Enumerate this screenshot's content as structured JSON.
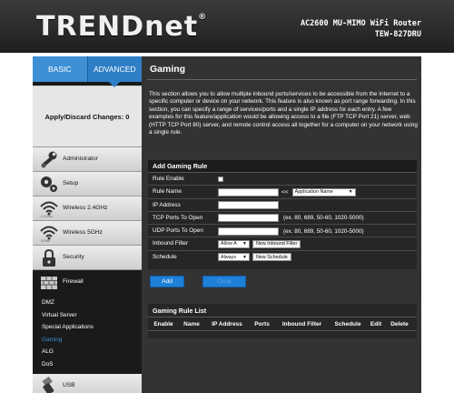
{
  "header": {
    "logo": "TRENDnet",
    "logo_reg": "®",
    "model_line1": "AC2600 MU-MIMO WiFi Router",
    "model_line2": "TEW-827DRU"
  },
  "tabs": {
    "basic": "BASIC",
    "advanced": "ADVANCED",
    "active": "ADVANCED"
  },
  "apply_label": "Apply/Discard Changes: 0",
  "nav": {
    "administrator": {
      "label": "Administrator",
      "icon": "wrench-icon"
    },
    "setup": {
      "label": "Setup",
      "icon": "gears-icon"
    },
    "wireless24": {
      "label": "Wireless 2.4GHz",
      "sub": "2.4 GHz",
      "icon": "wifi-icon"
    },
    "wireless5": {
      "label": "Wireless 5GHz",
      "sub": "5 GHz",
      "icon": "wifi-icon"
    },
    "security": {
      "label": "Security",
      "icon": "padlock-icon"
    },
    "firewall": {
      "label": "Firewall",
      "icon": "brick-wall-icon"
    },
    "firewall_sub": [
      "DMZ",
      "Virtual Server",
      "Special Applications",
      "Gaming",
      "ALG",
      "DoS"
    ],
    "firewall_active": "Gaming",
    "usb": {
      "label": "USB",
      "icon": "usb-icon"
    }
  },
  "page": {
    "title": "Gaming",
    "description": "This section allows you to allow multiple inbound ports/services to be accessible from the Internet to a specific computer or device on your network. This feature is also known as port range forwarding. In this section, you can specify a range of services/ports and a single IP address for each entry. A few examples for this feature/application would be allowing access to a file (FTP TCP Port 21) server, web (HTTP TCP Port 80) server, and remote control access all together for a computer on your network using a single rule."
  },
  "form": {
    "title": "Add Gaming Rule",
    "rule_enable_label": "Rule Enable",
    "rule_name_label": "Rule Name",
    "rule_name_value": "",
    "copy_arrows": "<<",
    "app_select_value": "Application Name",
    "ip_label": "IP Address",
    "ip_value": "",
    "tcp_label": "TCP Ports To Open",
    "tcp_value": "",
    "tcp_hint": "(ex. 80, 689, 50-60, 1020-5000)",
    "udp_label": "UDP Ports To Open",
    "udp_value": "",
    "udp_hint": "(ex. 80, 689, 50-60, 1020-5000)",
    "inbound_label": "Inbound Filter",
    "inbound_value": "Allow A",
    "new_inbound_label": "New Inbound Filter",
    "schedule_label": "Schedule",
    "schedule_value": "Always",
    "new_schedule_label": "New Schedule"
  },
  "buttons": {
    "add": "Add",
    "clear": "Clear"
  },
  "list": {
    "title": "Gaming Rule List",
    "columns": [
      "Enable",
      "Name",
      "IP Address",
      "Ports",
      "Inbound Filter",
      "Schedule",
      "Edit",
      "Delete"
    ]
  },
  "colors": {
    "accent": "#3e8fd4",
    "active_link": "#3e8fd4",
    "button": "#1f80d8"
  }
}
